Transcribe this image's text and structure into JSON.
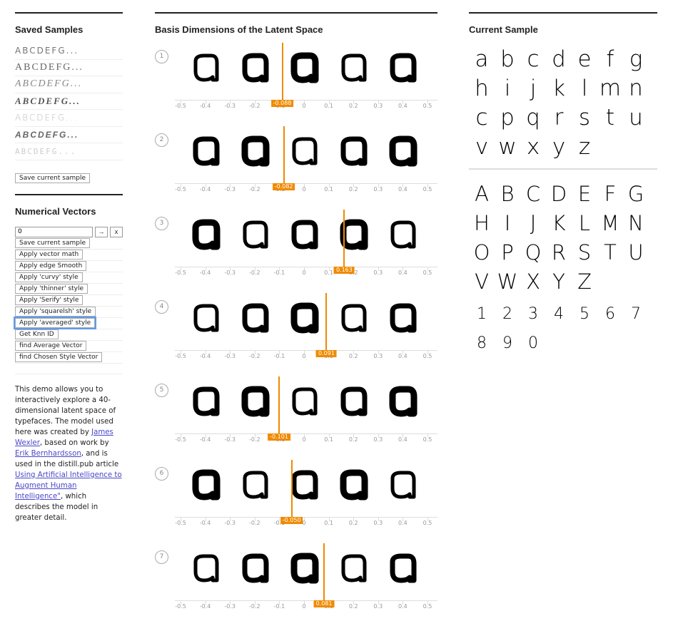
{
  "saved_samples": {
    "title": "Saved Samples",
    "rows": [
      "ABCDEFG...",
      "ABCDEFG...",
      "ABCDEFG...",
      "ABCDEFG...",
      "ABCDEFG...",
      "ABCDEFG...",
      "ABCDEFG..."
    ],
    "save_button": "Save current sample"
  },
  "numerical_vectors": {
    "title": "Numerical Vectors",
    "input_value": "0",
    "arrow_label": "→",
    "clear_label": "x",
    "buttons": [
      "Save current sample",
      "Apply vector math",
      "Apply edge Smooth",
      "Apply 'curvy' style",
      "Apply 'thinner' style",
      "Apply 'Serify' style",
      "Apply 'squarelsh' style",
      "Apply 'averaged' style",
      "Get Knn ID",
      "find Average Vector",
      "find Chosen Style Vector"
    ]
  },
  "description": {
    "p1": "This demo allows you to interactively explore a 40-dimensional latent space of typefaces. The model used here was created by ",
    "link1": "James Wexler",
    "p2": ", based on work by ",
    "link2": "Erik Bernhardsson",
    "p3": ", and is used in the distill.pub article ",
    "link3": "Using Artificial Intelligence to Augment Human Intelligence\"",
    "p4": ", which describes the model in greater detail."
  },
  "basis": {
    "title": "Basis Dimensions of the Latent Space",
    "tick_labels": [
      "-0.5",
      "-0.4",
      "-0.3",
      "-0.2",
      "-0.1",
      "0",
      "0.1",
      "0.2",
      "0.3",
      "0.4",
      "0.5"
    ],
    "dimensions": [
      {
        "num": "1",
        "value": -0.088,
        "value_label": "-0.088"
      },
      {
        "num": "2",
        "value": -0.082,
        "value_label": "-0.082"
      },
      {
        "num": "3",
        "value": 0.163,
        "value_label": "0.163"
      },
      {
        "num": "4",
        "value": 0.091,
        "value_label": "0.091"
      },
      {
        "num": "5",
        "value": -0.101,
        "value_label": "-0.101"
      },
      {
        "num": "6",
        "value": -0.05,
        "value_label": "-0.050"
      },
      {
        "num": "7",
        "value": 0.081,
        "value_label": "0.081"
      }
    ]
  },
  "current_sample": {
    "title": "Current Sample",
    "lower_rows": [
      [
        "a",
        "b",
        "c",
        "d",
        "e",
        "f",
        "g"
      ],
      [
        "h",
        "i",
        "j",
        "k",
        "l",
        "m",
        "n"
      ],
      [
        "c",
        "p",
        "q",
        "r",
        "s",
        "t",
        "u"
      ],
      [
        "v",
        "w",
        "x",
        "y",
        "z"
      ]
    ],
    "upper_rows": [
      [
        "A",
        "B",
        "C",
        "D",
        "E",
        "F",
        "G"
      ],
      [
        "H",
        "I",
        "J",
        "K",
        "L",
        "M",
        "N"
      ],
      [
        "O",
        "P",
        "Q",
        "R",
        "S",
        "T",
        "U"
      ],
      [
        "V",
        "W",
        "X",
        "Y",
        "Z"
      ]
    ],
    "digit_rows": [
      [
        "1",
        "2",
        "3",
        "4",
        "5",
        "6",
        "7"
      ],
      [
        "8",
        "9",
        "0"
      ]
    ]
  },
  "colors": {
    "accent": "#f08a00",
    "link": "#4b46c8",
    "focus": "#5b9bf0"
  }
}
